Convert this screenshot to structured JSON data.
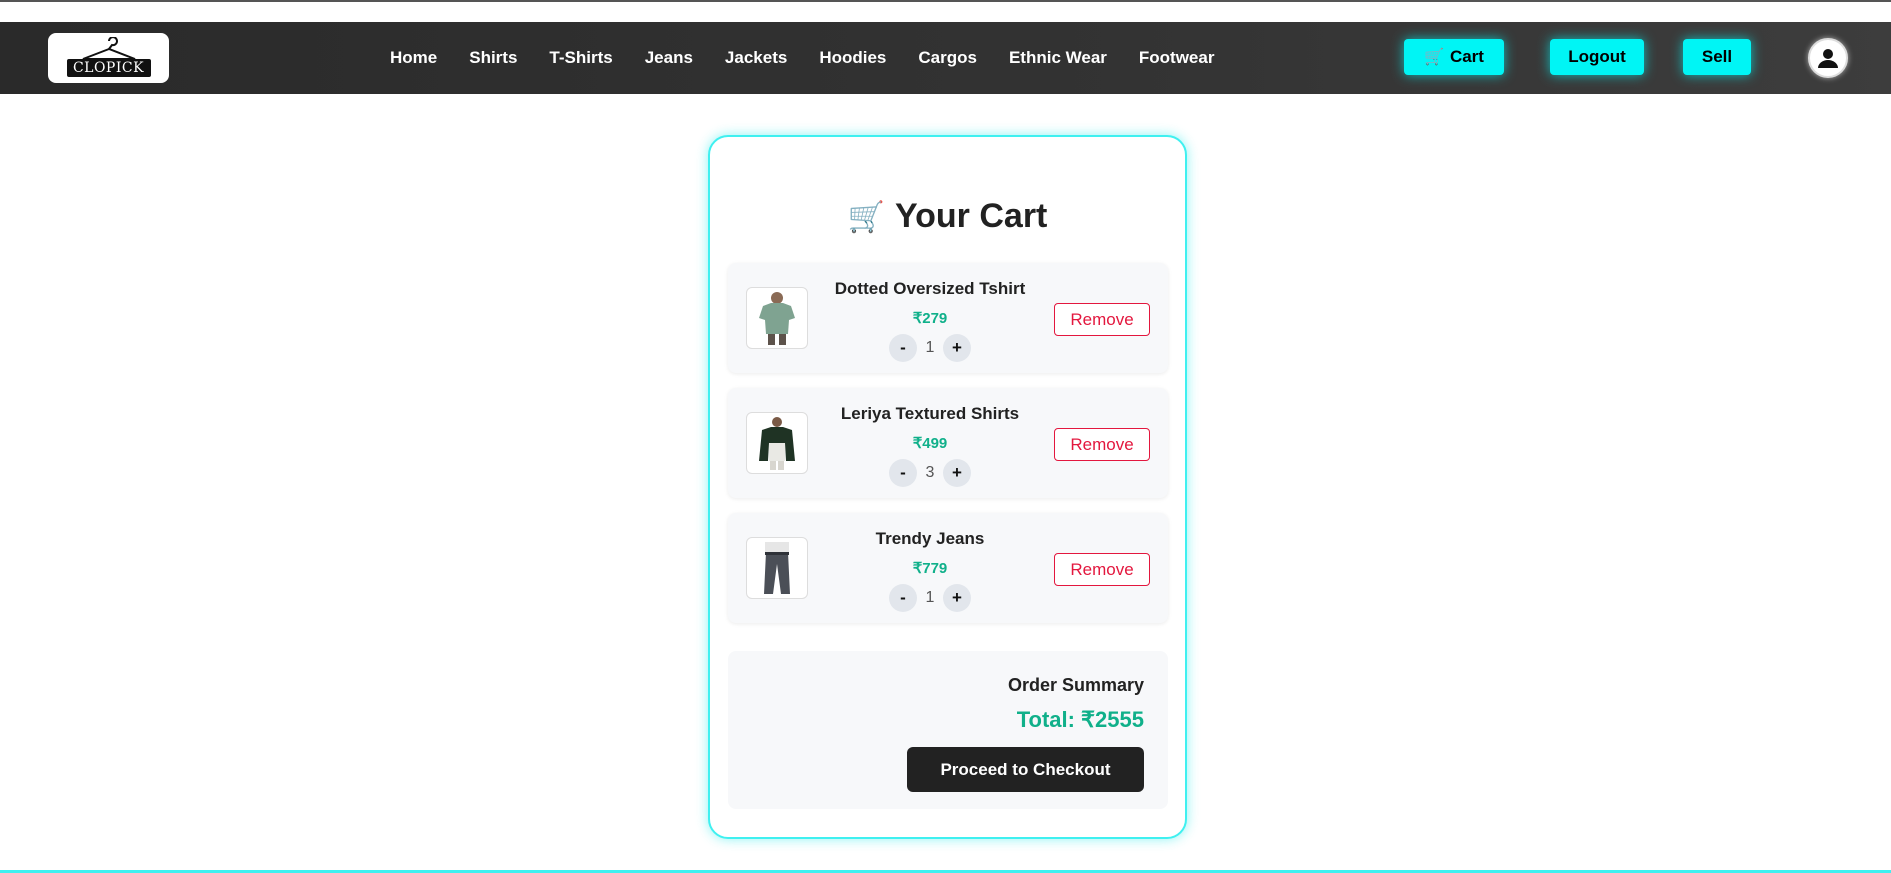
{
  "header": {
    "logo_text": "CLOPICK",
    "nav": [
      "Home",
      "Shirts",
      "T-Shirts",
      "Jeans",
      "Jackets",
      "Hoodies",
      "Cargos",
      "Ethnic Wear",
      "Footwear"
    ],
    "cart_icon": "🛒",
    "cart_label": "Cart",
    "logout_label": "Logout",
    "sell_label": "Sell",
    "avatar_icon": "user-icon"
  },
  "cart": {
    "title_icon": "🛒",
    "title": "Your Cart",
    "items": [
      {
        "name": "Dotted Oversized Tshirt",
        "price": "₹279",
        "qty": "1",
        "minus": "-",
        "plus": "+",
        "remove": "Remove",
        "image_icon": "tshirt-icon"
      },
      {
        "name": "Leriya Textured Shirts",
        "price": "₹499",
        "qty": "3",
        "minus": "-",
        "plus": "+",
        "remove": "Remove",
        "image_icon": "shirt-icon"
      },
      {
        "name": "Trendy Jeans",
        "price": "₹779",
        "qty": "1",
        "minus": "-",
        "plus": "+",
        "remove": "Remove",
        "image_icon": "jeans-icon"
      }
    ],
    "summary": {
      "title": "Order Summary",
      "total": "Total: ₹2555",
      "checkout": "Proceed to Checkout"
    }
  },
  "colors": {
    "accent": "#00f5f5",
    "price": "#10b08a",
    "remove": "#e3173e",
    "navbar": "#2f2f2f"
  }
}
